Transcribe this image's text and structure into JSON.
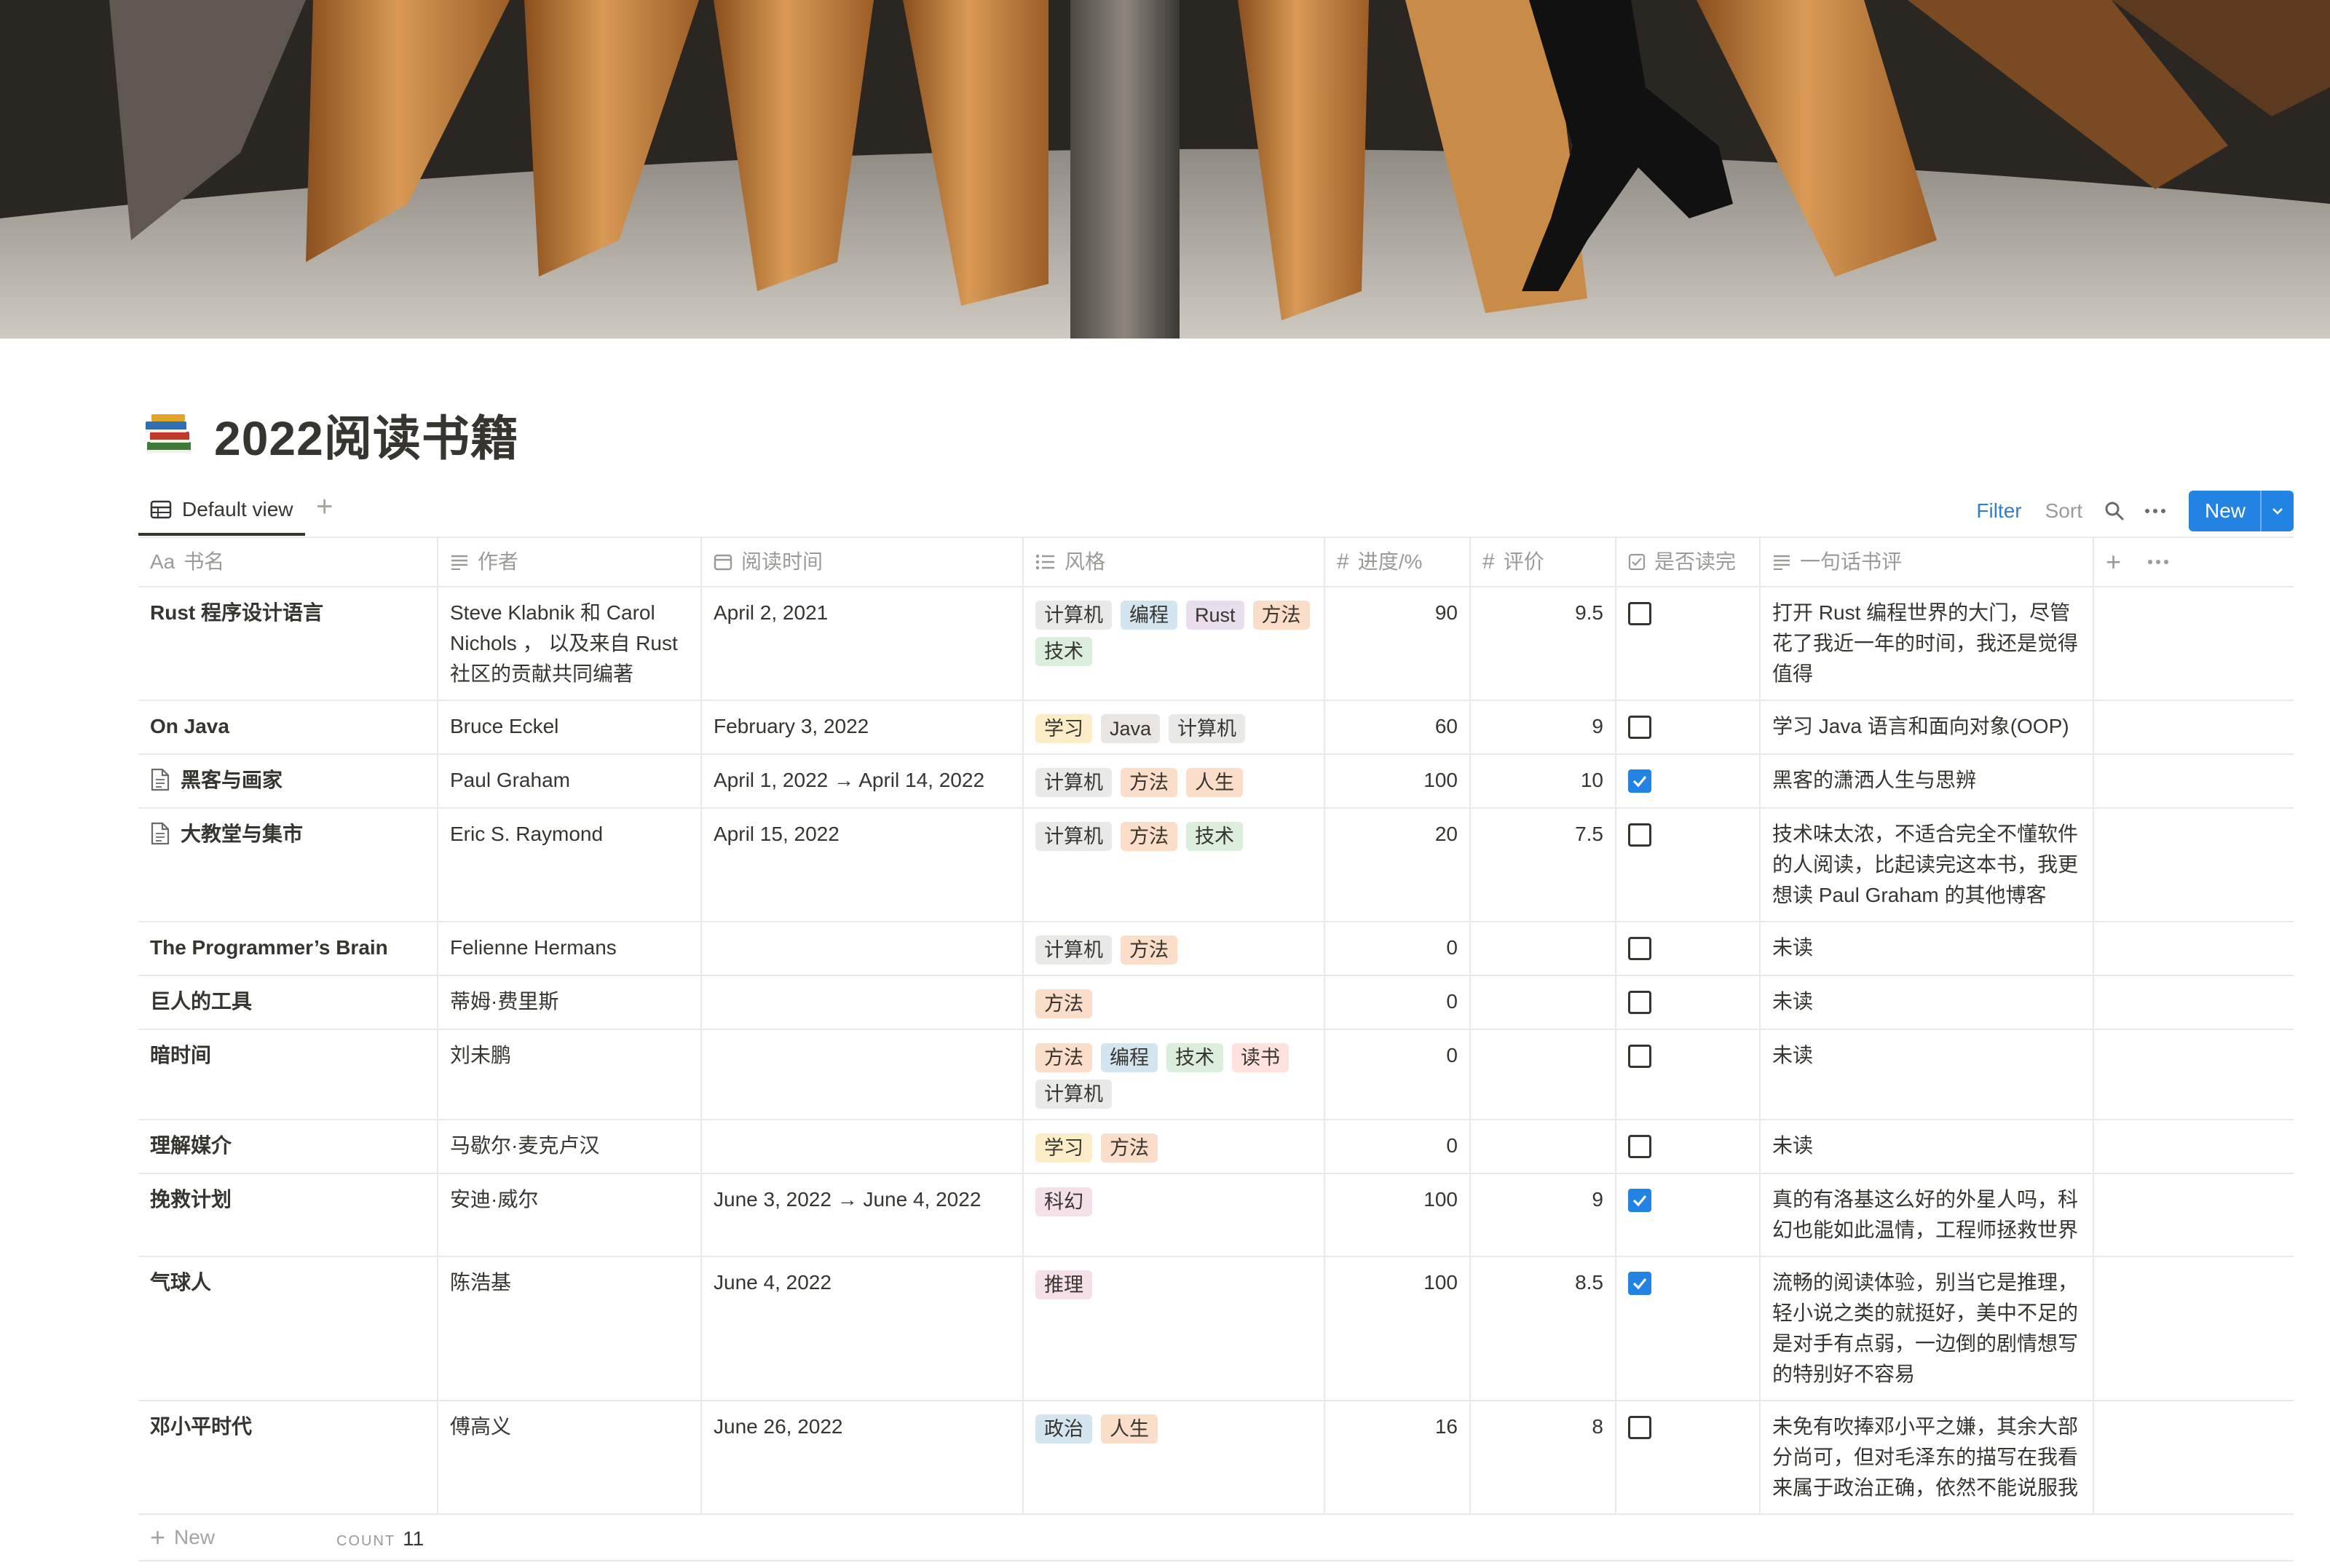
{
  "page": {
    "title": "2022阅读书籍",
    "emoji_icon": "books-icon"
  },
  "views": {
    "active_tab": "Default view",
    "add_icon": "plus-icon"
  },
  "toolbar": {
    "filter": "Filter",
    "sort": "Sort",
    "search_icon": "search-icon",
    "more_icon": "ellipsis-icon",
    "new_label": "New",
    "accent": "#2383e2",
    "filter_color": "#2e7fcc"
  },
  "columns": {
    "name": "书名",
    "name_prefix": "Aa",
    "author": "作者",
    "date": "阅读时间",
    "style": "风格",
    "progress": "进度/%",
    "rating": "评价",
    "done": "是否读完",
    "review": "一句话书评"
  },
  "tag_colors": {
    "计算机": "#e9e9e7",
    "编程": "#d3e5ef",
    "Rust": "#e8deee",
    "方法": "#fadec9",
    "技术": "#dbeddb",
    "学习": "#fdecc8",
    "Java": "#e9e5e3",
    "人生": "#fadec9",
    "读书": "#ffe2dd",
    "科幻": "#f5e0e9",
    "推理": "#f5e0e9",
    "政治": "#d3e5ef"
  },
  "rows": [
    {
      "name": "Rust 程序设计语言",
      "page_icon": false,
      "author": "Steve Klabnik 和 Carol Nichols ， 以及来自 Rust 社区的贡献共同编著",
      "date": "April 2, 2021",
      "tags": [
        "计算机",
        "编程",
        "Rust",
        "方法",
        "技术"
      ],
      "progress": "90",
      "rating": "9.5",
      "done": false,
      "review": "打开 Rust 编程世界的大门，尽管花了我近一年的时间，我还是觉得值得"
    },
    {
      "name": "On Java",
      "page_icon": false,
      "author": "Bruce Eckel",
      "date": "February 3, 2022",
      "tags": [
        "学习",
        "Java",
        "计算机"
      ],
      "progress": "60",
      "rating": "9",
      "done": false,
      "review": "学习 Java 语言和面向对象(OOP)"
    },
    {
      "name": "黑客与画家",
      "page_icon": true,
      "author": "Paul Graham",
      "date": "April 1, 2022 → April 14, 2022",
      "tags": [
        "计算机",
        "方法",
        "人生"
      ],
      "progress": "100",
      "rating": "10",
      "done": true,
      "review": "黑客的潇洒人生与思辨"
    },
    {
      "name": "大教堂与集市",
      "page_icon": true,
      "author": "Eric S. Raymond",
      "date": "April 15, 2022",
      "tags": [
        "计算机",
        "方法",
        "技术"
      ],
      "progress": "20",
      "rating": "7.5",
      "done": false,
      "review": "技术味太浓，不适合完全不懂软件的人阅读，比起读完这本书，我更想读 Paul Graham 的其他博客"
    },
    {
      "name": "The Programmer’s Brain",
      "page_icon": false,
      "author": "Felienne Hermans",
      "date": "",
      "tags": [
        "计算机",
        "方法"
      ],
      "progress": "0",
      "rating": "",
      "done": false,
      "review": "未读"
    },
    {
      "name": "巨人的工具",
      "page_icon": false,
      "author": "蒂姆·费里斯",
      "date": "",
      "tags": [
        "方法"
      ],
      "progress": "0",
      "rating": "",
      "done": false,
      "review": "未读"
    },
    {
      "name": "暗时间",
      "page_icon": false,
      "author": "刘未鹏",
      "date": "",
      "tags": [
        "方法",
        "编程",
        "技术",
        "读书",
        "计算机"
      ],
      "progress": "0",
      "rating": "",
      "done": false,
      "review": "未读"
    },
    {
      "name": "理解媒介",
      "page_icon": false,
      "author": "马歇尔·麦克卢汉",
      "date": "",
      "tags": [
        "学习",
        "方法"
      ],
      "progress": "0",
      "rating": "",
      "done": false,
      "review": "未读"
    },
    {
      "name": "挽救计划",
      "page_icon": false,
      "author": "安迪·威尔",
      "date": "June 3, 2022 → June 4, 2022",
      "tags": [
        "科幻"
      ],
      "progress": "100",
      "rating": "9",
      "done": true,
      "review": "真的有洛基这么好的外星人吗，科幻也能如此温情，工程师拯救世界"
    },
    {
      "name": "气球人",
      "page_icon": false,
      "author": "陈浩基",
      "date": "June 4, 2022",
      "tags": [
        "推理"
      ],
      "progress": "100",
      "rating": "8.5",
      "done": true,
      "review": "流畅的阅读体验，别当它是推理，轻小说之类的就挺好，美中不足的是对手有点弱，一边倒的剧情想写的特别好不容易"
    },
    {
      "name": "邓小平时代",
      "page_icon": false,
      "author": "傅高义",
      "date": "June 26, 2022",
      "tags": [
        "政治",
        "人生"
      ],
      "progress": "16",
      "rating": "8",
      "done": false,
      "review": "未免有吹捧邓小平之嫌，其余大部分尚可，但对毛泽东的描写在我看来属于政治正确，依然不能说服我"
    }
  ],
  "footer": {
    "new_row": "New",
    "count_label": "COUNT",
    "count_value": "11"
  }
}
